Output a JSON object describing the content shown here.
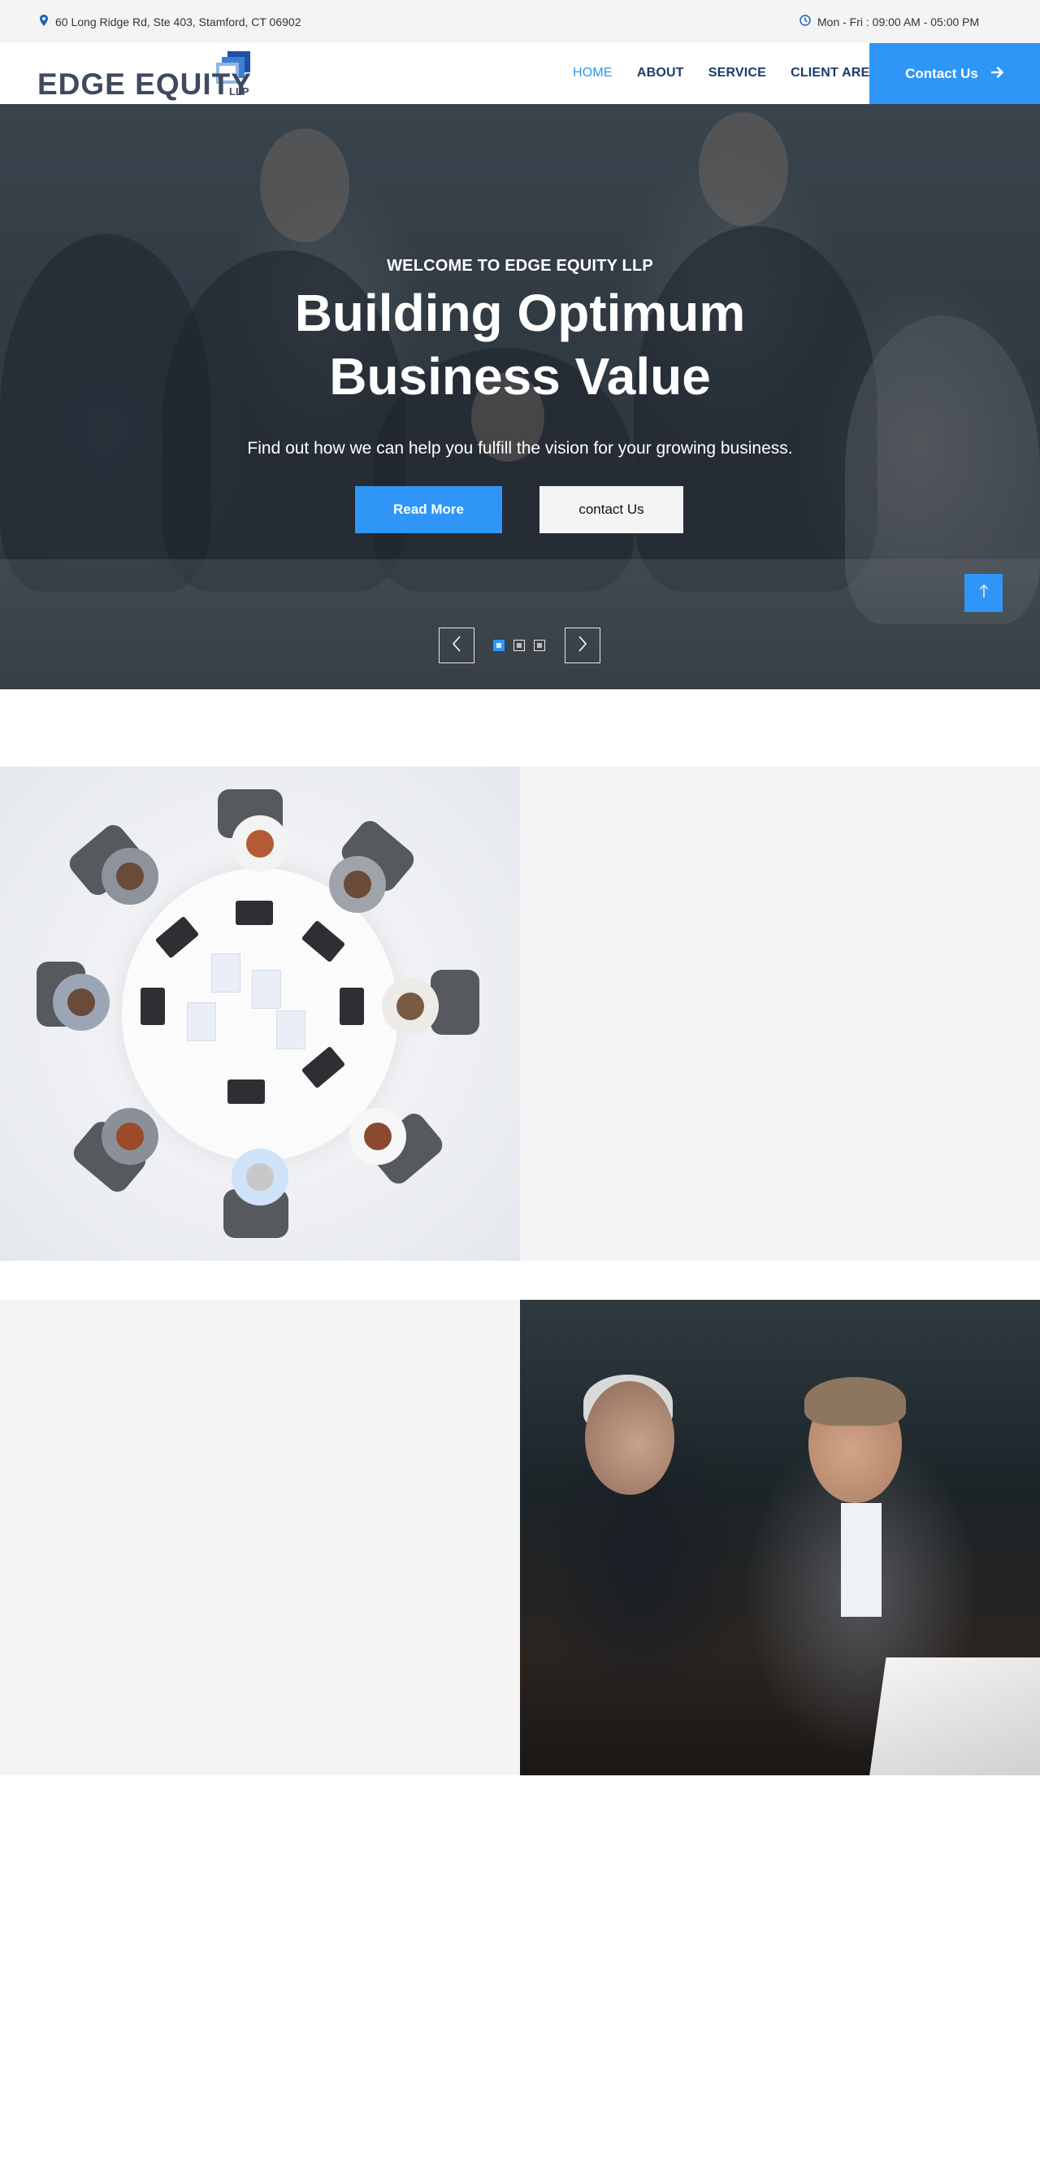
{
  "topbar": {
    "address": "60 Long Ridge Rd, Ste 403, Stamford, CT 06902",
    "hours": "Mon - Fri : 09:00 AM - 05:00 PM",
    "address_icon": "map-pin-icon",
    "hours_icon": "clock-icon"
  },
  "header": {
    "logo_text": "EDGE EQUITY",
    "logo_suffix": "LLP",
    "nav": [
      {
        "label": "HOME",
        "active": true
      },
      {
        "label": "ABOUT",
        "active": false
      },
      {
        "label": "SERVICE",
        "active": false
      },
      {
        "label": "CLIENT AREA",
        "active": false
      }
    ],
    "contact_label": "Contact Us",
    "contact_icon": "arrow-right-icon"
  },
  "hero": {
    "kicker": "WELCOME TO EDGE EQUITY LLP",
    "title_line1": "Building Optimum",
    "title_line2": "Business Value",
    "subtitle": "Find out how we can help you fulfill the vision for your growing business.",
    "read_more_label": "Read More",
    "contact_label": "contact Us",
    "slides": 3,
    "active_slide": 1
  },
  "colors": {
    "accent": "#2f96f8",
    "nav": "#1c3b6b",
    "logo": "#3e4a5f",
    "topbar_bg": "#f4f4f4",
    "panel_bg": "#f4f4f4"
  }
}
